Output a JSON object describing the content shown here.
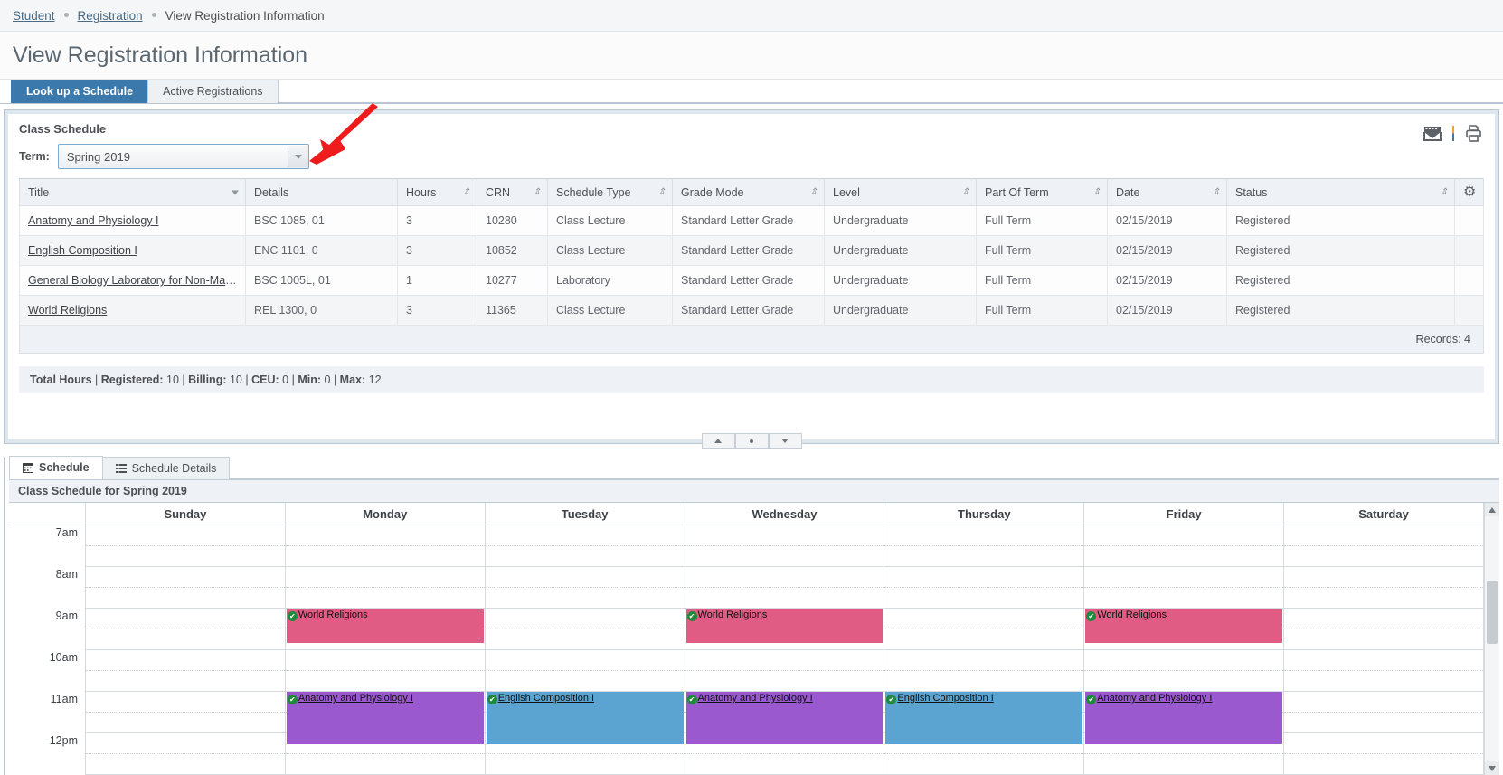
{
  "breadcrumb": {
    "items": [
      {
        "label": "Student",
        "link": true
      },
      {
        "label": "Registration",
        "link": true
      },
      {
        "label": "View Registration Information",
        "link": false
      }
    ]
  },
  "page": {
    "title": "View Registration Information"
  },
  "tabs": [
    {
      "label": "Look up a Schedule",
      "active": true
    },
    {
      "label": "Active Registrations",
      "active": false
    }
  ],
  "class_schedule": {
    "heading": "Class Schedule",
    "term_label": "Term:",
    "term_value": "Spring 2019",
    "icons": {
      "email": "calendar-email-icon",
      "print": "printer-icon",
      "gear": "gear-icon"
    },
    "columns": [
      "Title",
      "Details",
      "Hours",
      "CRN",
      "Schedule Type",
      "Grade Mode",
      "Level",
      "Part Of Term",
      "Date",
      "Status"
    ],
    "rows": [
      {
        "title": "Anatomy and Physiology I",
        "details": "BSC 1085, 01",
        "hours": "3",
        "crn": "10280",
        "schedule_type": "Class Lecture",
        "grade_mode": "Standard Letter Grade",
        "level": "Undergraduate",
        "part_of_term": "Full Term",
        "date": "02/15/2019",
        "status": "Registered"
      },
      {
        "title": "English Composition I",
        "details": "ENC 1101, 0",
        "hours": "3",
        "crn": "10852",
        "schedule_type": "Class Lecture",
        "grade_mode": "Standard Letter Grade",
        "level": "Undergraduate",
        "part_of_term": "Full Term",
        "date": "02/15/2019",
        "status": "Registered"
      },
      {
        "title": "General Biology Laboratory for Non-Majors",
        "details": "BSC 1005L, 01",
        "hours": "1",
        "crn": "10277",
        "schedule_type": "Laboratory",
        "grade_mode": "Standard Letter Grade",
        "level": "Undergraduate",
        "part_of_term": "Full Term",
        "date": "02/15/2019",
        "status": "Registered"
      },
      {
        "title": "World Religions",
        "details": "REL 1300, 0",
        "hours": "3",
        "crn": "11365",
        "schedule_type": "Class Lecture",
        "grade_mode": "Standard Letter Grade",
        "level": "Undergraduate",
        "part_of_term": "Full Term",
        "date": "02/15/2019",
        "status": "Registered"
      }
    ],
    "records_label": "Records: 4",
    "totals": {
      "prefix": "Total Hours",
      "registered_label": "Registered:",
      "registered": "10",
      "billing_label": "Billing:",
      "billing": "10",
      "ceu_label": "CEU:",
      "ceu": "0",
      "min_label": "Min:",
      "min": "0",
      "max_label": "Max:",
      "max": "12"
    }
  },
  "schedule_panel": {
    "tabs": [
      {
        "label": "Schedule",
        "icon": "calendar-icon",
        "active": true
      },
      {
        "label": "Schedule Details",
        "icon": "list-icon",
        "active": false
      }
    ],
    "caption": "Class Schedule for Spring 2019",
    "days": [
      "Sunday",
      "Monday",
      "Tuesday",
      "Wednesday",
      "Thursday",
      "Friday",
      "Saturday"
    ],
    "time_labels": [
      "7am",
      "8am",
      "9am",
      "10am",
      "11am",
      "12pm"
    ],
    "colors": {
      "world_religions": "#e05c85",
      "anatomy": "#9b59d0",
      "english": "#5ba3d0"
    },
    "events": [
      {
        "title": "World Religions",
        "day": "Monday",
        "start": "9am",
        "color_key": "world_religions",
        "row": 4,
        "span": 2
      },
      {
        "title": "World Religions",
        "day": "Wednesday",
        "start": "9am",
        "color_key": "world_religions",
        "row": 4,
        "span": 2
      },
      {
        "title": "World Religions",
        "day": "Friday",
        "start": "9am",
        "color_key": "world_religions",
        "row": 4,
        "span": 2
      },
      {
        "title": "Anatomy and Physiology I",
        "day": "Monday",
        "start": "11am",
        "color_key": "anatomy",
        "row": 8,
        "span": 3
      },
      {
        "title": "Anatomy and Physiology I",
        "day": "Wednesday",
        "start": "11am",
        "color_key": "anatomy",
        "row": 8,
        "span": 3
      },
      {
        "title": "Anatomy and Physiology I",
        "day": "Friday",
        "start": "11am",
        "color_key": "anatomy",
        "row": 8,
        "span": 3
      },
      {
        "title": "English Composition I",
        "day": "Tuesday",
        "start": "11am",
        "color_key": "english",
        "row": 8,
        "span": 3
      },
      {
        "title": "English Composition I",
        "day": "Thursday",
        "start": "11am",
        "color_key": "english",
        "row": 8,
        "span": 3
      }
    ]
  }
}
